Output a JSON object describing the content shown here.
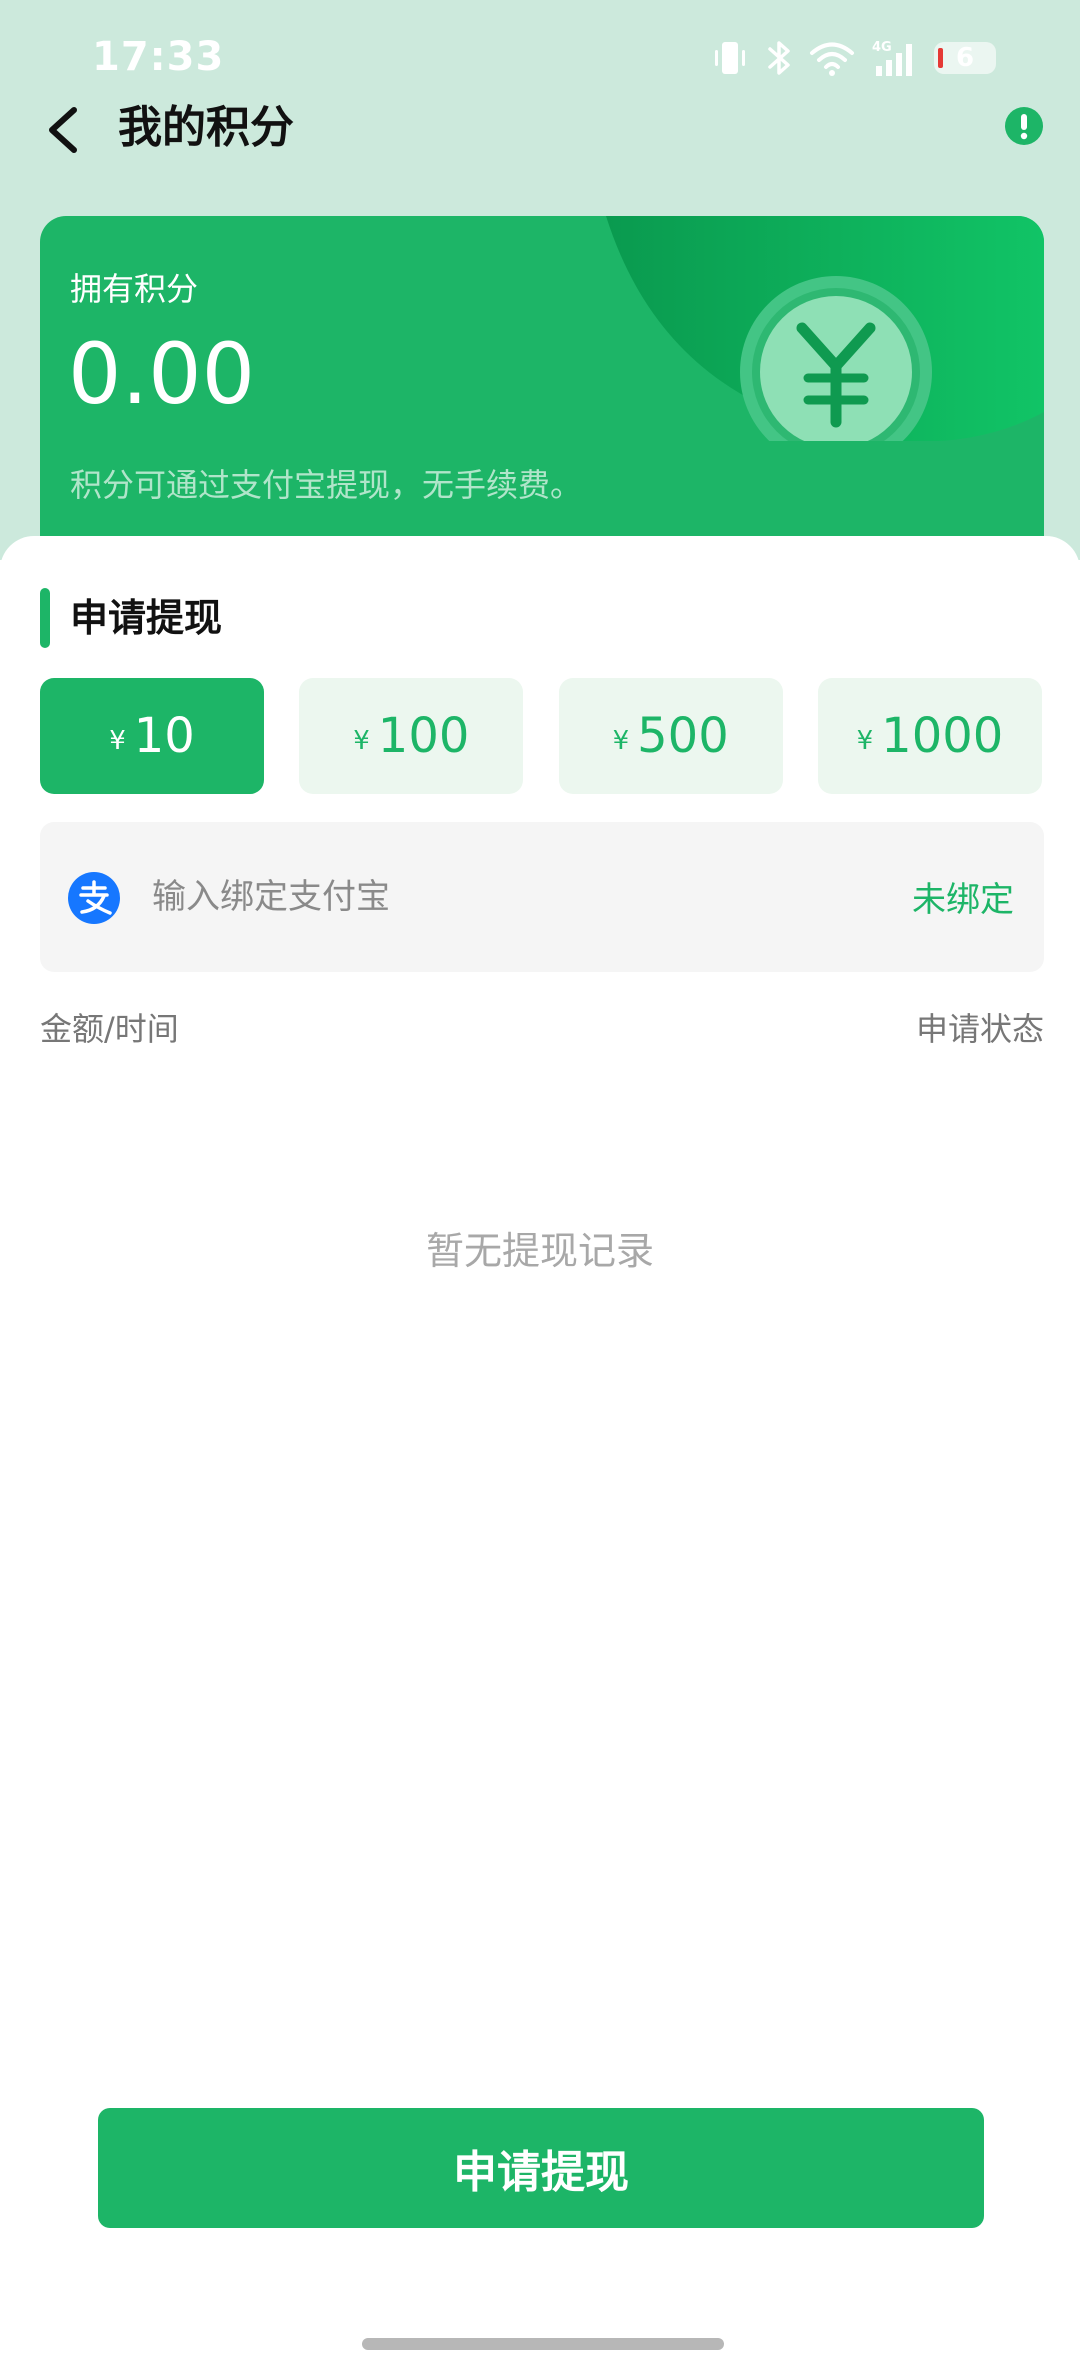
{
  "status_bar": {
    "time": "17:33",
    "battery_level": "6",
    "network_label": "4G",
    "icons": [
      "vibrate-icon",
      "bluetooth-icon",
      "wifi-icon",
      "signal-icon",
      "battery-icon"
    ]
  },
  "header": {
    "title": "我的积分",
    "back_icon": "chevron-left-icon",
    "info_icon": "info-icon"
  },
  "points_card": {
    "label": "拥有积分",
    "value": "0.00",
    "description": "积分可通过支付宝提现，无手续费。",
    "decor_icon": "yuan-coin-icon"
  },
  "withdraw": {
    "section_title": "申请提现",
    "currency_symbol": "¥",
    "amounts": [
      {
        "value": "10",
        "selected": true
      },
      {
        "value": "100",
        "selected": false
      },
      {
        "value": "500",
        "selected": false
      },
      {
        "value": "1000",
        "selected": false
      }
    ],
    "alipay": {
      "icon": "alipay-icon",
      "placeholder": "输入绑定支付宝",
      "status": "未绑定"
    }
  },
  "records": {
    "col_left": "金额/时间",
    "col_right": "申请状态",
    "empty_text": "暂无提现记录"
  },
  "submit_label": "申请提现",
  "colors": {
    "accent": "#1db567",
    "top_background": "#cce9dc",
    "amount_bg": "#ecf7ef",
    "alipay_blue": "#1677ff"
  }
}
